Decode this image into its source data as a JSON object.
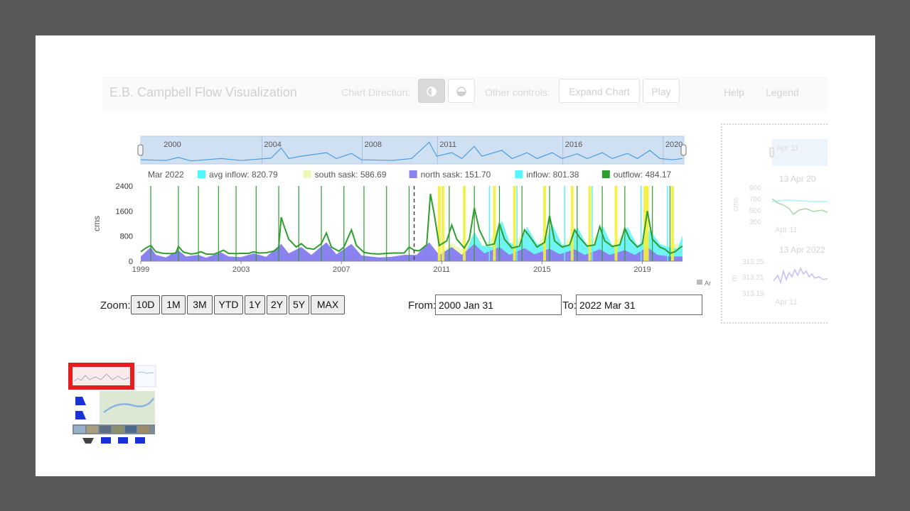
{
  "app_title": "E.B. Campbell Flow Visualization",
  "navbar": {
    "chart_direction_label": "Chart Direction:",
    "other_controls_label": "Other controls:",
    "expand_chart_label": "Expand Chart",
    "play_label": "Play",
    "help_label": "Help",
    "legend_label": "Legend",
    "direction_icon_1": "half-circle-vertical-icon",
    "direction_icon_2": "half-circle-horizontal-icon"
  },
  "zoom": {
    "label": "Zoom:",
    "buttons": [
      "10D",
      "1M",
      "3M",
      "YTD",
      "1Y",
      "2Y",
      "5Y",
      "MAX"
    ]
  },
  "range": {
    "from_label": "From:",
    "from_value": "2000 Jan 31",
    "to_label": "To:",
    "to_value": "2022 Mar 31"
  },
  "side_panel": {
    "scroller_label": "Apr 11",
    "plot1_title": "13 Apr 20",
    "plot1_ylabel": "cms",
    "plot1_ticks": [
      "900",
      "700",
      "500",
      "300"
    ],
    "plot1_xlabel": "Apr 11",
    "plot2_title": "13 Apr 2022",
    "plot2_ylabel": "m",
    "plot2_ticks": [
      "313.25",
      "313.21",
      "313.19"
    ],
    "plot2_xlabel": "Apr 11"
  },
  "chart_data": {
    "type": "area",
    "credit": "AnyChart",
    "ylabel": "cms",
    "ylim": [
      0,
      2400
    ],
    "yticks": [
      "0",
      "800",
      "1600",
      "2400"
    ],
    "xlim": [
      1999,
      2020.6
    ],
    "xticks": [
      "1999",
      "2003",
      "2007",
      "2011",
      "2015",
      "2019"
    ],
    "scroller_ticks": [
      "2000",
      "2004",
      "2008",
      "2011",
      "2016",
      "2020"
    ],
    "current_marker_x": 2009.9,
    "legend": {
      "date": "Mar 2022",
      "items": [
        {
          "label": "avg inflow: 820.79",
          "color": "#4ff5ff"
        },
        {
          "label": "south sask: 586.69",
          "color": "#eef7b8"
        },
        {
          "label": "north sask: 151.70",
          "color": "#8a82f0"
        },
        {
          "label": "inflow: 801.38",
          "color": "#59f2ff"
        },
        {
          "label": "outflow: 484.17",
          "color": "#2e9e2e"
        }
      ]
    },
    "series": [
      {
        "name": "north sask",
        "color": "#8a82f0"
      },
      {
        "name": "outflow",
        "color": "#2e9e2e"
      },
      {
        "name": "inflow",
        "color": "#59f2ff"
      },
      {
        "name": "south sask",
        "color": "#eef7b8"
      }
    ],
    "green_events": [
      1999.4,
      2000.5,
      2001.3,
      2002.1,
      2002.8,
      2003.6,
      2004.5,
      2005.3,
      2006.2,
      2007.1,
      2007.9,
      2008.8,
      2009.7,
      2011.3,
      2012.3,
      2013.3,
      2014.2,
      2015.3,
      2016.4,
      2017.4,
      2018.3,
      2019.4,
      2020.1
    ],
    "yellow_events": [
      2010.9,
      2011.05,
      2011.9,
      2013.1,
      2013.9,
      2015.1,
      2016.2,
      2016.9,
      2017.95,
      2019.1,
      2019.2,
      2020.2
    ],
    "cyan_events": [
      2012.9,
      2014.0,
      2015.9,
      2017.0,
      2018.95,
      2020.0
    ],
    "outflow_points": [
      [
        1999.0,
        300
      ],
      [
        1999.2,
        420
      ],
      [
        1999.4,
        500
      ],
      [
        1999.6,
        300
      ],
      [
        1999.9,
        250
      ],
      [
        2000.2,
        240
      ],
      [
        2000.4,
        260
      ],
      [
        2000.5,
        470
      ],
      [
        2000.7,
        290
      ],
      [
        2001.0,
        230
      ],
      [
        2001.2,
        250
      ],
      [
        2001.4,
        300
      ],
      [
        2001.6,
        230
      ],
      [
        2001.9,
        220
      ],
      [
        2002.1,
        280
      ],
      [
        2002.3,
        350
      ],
      [
        2002.5,
        250
      ],
      [
        2002.8,
        240
      ],
      [
        2003.0,
        250
      ],
      [
        2003.3,
        250
      ],
      [
        2003.5,
        300
      ],
      [
        2003.7,
        260
      ],
      [
        2004.0,
        270
      ],
      [
        2004.3,
        320
      ],
      [
        2004.5,
        450
      ],
      [
        2004.6,
        1400
      ],
      [
        2004.7,
        1150
      ],
      [
        2004.9,
        700
      ],
      [
        2005.2,
        450
      ],
      [
        2005.4,
        560
      ],
      [
        2005.6,
        420
      ],
      [
        2005.9,
        380
      ],
      [
        2006.2,
        560
      ],
      [
        2006.4,
        900
      ],
      [
        2006.6,
        450
      ],
      [
        2006.9,
        320
      ],
      [
        2007.1,
        450
      ],
      [
        2007.4,
        1000
      ],
      [
        2007.6,
        500
      ],
      [
        2007.9,
        280
      ],
      [
        2008.2,
        240
      ],
      [
        2008.5,
        230
      ],
      [
        2008.8,
        250
      ],
      [
        2009.1,
        260
      ],
      [
        2009.5,
        260
      ],
      [
        2009.7,
        450
      ],
      [
        2009.9,
        350
      ],
      [
        2010.1,
        330
      ],
      [
        2010.4,
        520
      ],
      [
        2010.55,
        2150
      ],
      [
        2010.7,
        1500
      ],
      [
        2010.9,
        500
      ],
      [
        2011.2,
        650
      ],
      [
        2011.4,
        1150
      ],
      [
        2011.6,
        700
      ],
      [
        2011.9,
        420
      ],
      [
        2012.1,
        700
      ],
      [
        2012.3,
        1700
      ],
      [
        2012.5,
        1000
      ],
      [
        2012.8,
        500
      ],
      [
        2013.1,
        550
      ],
      [
        2013.3,
        1200
      ],
      [
        2013.5,
        700
      ],
      [
        2013.8,
        420
      ],
      [
        2014.1,
        480
      ],
      [
        2014.3,
        1000
      ],
      [
        2014.5,
        800
      ],
      [
        2014.8,
        450
      ],
      [
        2015.1,
        600
      ],
      [
        2015.3,
        1450
      ],
      [
        2015.5,
        650
      ],
      [
        2015.8,
        450
      ],
      [
        2016.1,
        520
      ],
      [
        2016.3,
        1000
      ],
      [
        2016.5,
        750
      ],
      [
        2016.8,
        480
      ],
      [
        2017.1,
        520
      ],
      [
        2017.3,
        1100
      ],
      [
        2017.5,
        650
      ],
      [
        2017.8,
        470
      ],
      [
        2018.1,
        520
      ],
      [
        2018.3,
        1050
      ],
      [
        2018.5,
        700
      ],
      [
        2018.8,
        450
      ],
      [
        2019.0,
        550
      ],
      [
        2019.2,
        1600
      ],
      [
        2019.4,
        700
      ],
      [
        2019.7,
        450
      ],
      [
        2019.9,
        380
      ],
      [
        2020.1,
        250
      ],
      [
        2020.3,
        300
      ],
      [
        2020.5,
        430
      ],
      [
        2020.6,
        480
      ]
    ],
    "north_points": [
      [
        1999.0,
        150
      ],
      [
        1999.4,
        450
      ],
      [
        1999.6,
        200
      ],
      [
        2000.0,
        120
      ],
      [
        2000.5,
        350
      ],
      [
        2000.8,
        150
      ],
      [
        2001.3,
        200
      ],
      [
        2001.6,
        110
      ],
      [
        2002.2,
        280
      ],
      [
        2002.5,
        150
      ],
      [
        2003.0,
        130
      ],
      [
        2003.5,
        250
      ],
      [
        2004.0,
        140
      ],
      [
        2004.6,
        550
      ],
      [
        2004.9,
        250
      ],
      [
        2005.4,
        450
      ],
      [
        2005.8,
        200
      ],
      [
        2006.4,
        600
      ],
      [
        2006.8,
        220
      ],
      [
        2007.4,
        550
      ],
      [
        2007.8,
        180
      ],
      [
        2008.5,
        120
      ],
      [
        2009.0,
        140
      ],
      [
        2009.5,
        200
      ],
      [
        2010.0,
        200
      ],
      [
        2010.5,
        600
      ],
      [
        2010.9,
        200
      ],
      [
        2011.4,
        450
      ],
      [
        2011.8,
        200
      ],
      [
        2012.3,
        550
      ],
      [
        2012.7,
        250
      ],
      [
        2013.3,
        450
      ],
      [
        2013.7,
        200
      ],
      [
        2014.3,
        420
      ],
      [
        2014.7,
        220
      ],
      [
        2015.3,
        400
      ],
      [
        2015.7,
        220
      ],
      [
        2016.3,
        380
      ],
      [
        2016.7,
        200
      ],
      [
        2017.3,
        380
      ],
      [
        2017.7,
        200
      ],
      [
        2018.3,
        350
      ],
      [
        2018.7,
        200
      ],
      [
        2019.2,
        450
      ],
      [
        2019.6,
        200
      ],
      [
        2020.1,
        150
      ],
      [
        2020.6,
        150
      ]
    ],
    "inflow_points": [
      [
        2012.0,
        350
      ],
      [
        2012.3,
        950
      ],
      [
        2012.6,
        500
      ],
      [
        2013.0,
        450
      ],
      [
        2013.4,
        1300
      ],
      [
        2013.7,
        600
      ],
      [
        2014.1,
        450
      ],
      [
        2014.4,
        1100
      ],
      [
        2014.8,
        550
      ],
      [
        2015.1,
        550
      ],
      [
        2015.4,
        1200
      ],
      [
        2015.8,
        520
      ],
      [
        2016.1,
        500
      ],
      [
        2016.4,
        1100
      ],
      [
        2016.8,
        500
      ],
      [
        2017.1,
        500
      ],
      [
        2017.4,
        1150
      ],
      [
        2017.8,
        500
      ],
      [
        2018.1,
        550
      ],
      [
        2018.4,
        1100
      ],
      [
        2018.8,
        500
      ],
      [
        2019.0,
        600
      ],
      [
        2019.3,
        1000
      ],
      [
        2019.7,
        550
      ],
      [
        2020.0,
        450
      ],
      [
        2020.4,
        400
      ],
      [
        2020.6,
        820
      ]
    ],
    "south_points": [
      [
        2011.0,
        300
      ],
      [
        2011.4,
        600
      ],
      [
        2011.8,
        350
      ],
      [
        2012.3,
        900
      ],
      [
        2012.7,
        450
      ],
      [
        2013.3,
        1100
      ],
      [
        2013.7,
        500
      ],
      [
        2014.3,
        900
      ],
      [
        2014.7,
        450
      ],
      [
        2015.3,
        1000
      ],
      [
        2015.7,
        450
      ],
      [
        2016.3,
        900
      ],
      [
        2016.7,
        450
      ],
      [
        2017.3,
        950
      ],
      [
        2017.7,
        450
      ],
      [
        2018.3,
        900
      ],
      [
        2018.7,
        450
      ],
      [
        2019.3,
        800
      ],
      [
        2019.7,
        450
      ],
      [
        2020.6,
        590
      ]
    ],
    "scroller_points": [
      [
        1999.0,
        0.15
      ],
      [
        2000.0,
        0.12
      ],
      [
        2000.5,
        0.25
      ],
      [
        2001.0,
        0.1
      ],
      [
        2002.2,
        0.2
      ],
      [
        2003.0,
        0.12
      ],
      [
        2004.2,
        0.22
      ],
      [
        2004.6,
        0.65
      ],
      [
        2004.9,
        0.2
      ],
      [
        2005.4,
        0.3
      ],
      [
        2006.4,
        0.45
      ],
      [
        2006.8,
        0.2
      ],
      [
        2007.4,
        0.42
      ],
      [
        2007.8,
        0.15
      ],
      [
        2009.0,
        0.12
      ],
      [
        2009.8,
        0.2
      ],
      [
        2010.5,
        0.9
      ],
      [
        2010.8,
        0.3
      ],
      [
        2011.4,
        0.45
      ],
      [
        2011.8,
        0.2
      ],
      [
        2012.3,
        0.72
      ],
      [
        2012.6,
        0.3
      ],
      [
        2013.4,
        0.55
      ],
      [
        2013.8,
        0.2
      ],
      [
        2014.4,
        0.45
      ],
      [
        2014.8,
        0.2
      ],
      [
        2015.4,
        0.45
      ],
      [
        2015.8,
        0.2
      ],
      [
        2016.4,
        0.4
      ],
      [
        2016.8,
        0.2
      ],
      [
        2017.4,
        0.45
      ],
      [
        2017.8,
        0.2
      ],
      [
        2018.4,
        0.42
      ],
      [
        2018.8,
        0.2
      ],
      [
        2019.3,
        0.55
      ],
      [
        2019.7,
        0.2
      ],
      [
        2020.2,
        0.15
      ],
      [
        2020.6,
        0.2
      ]
    ]
  }
}
